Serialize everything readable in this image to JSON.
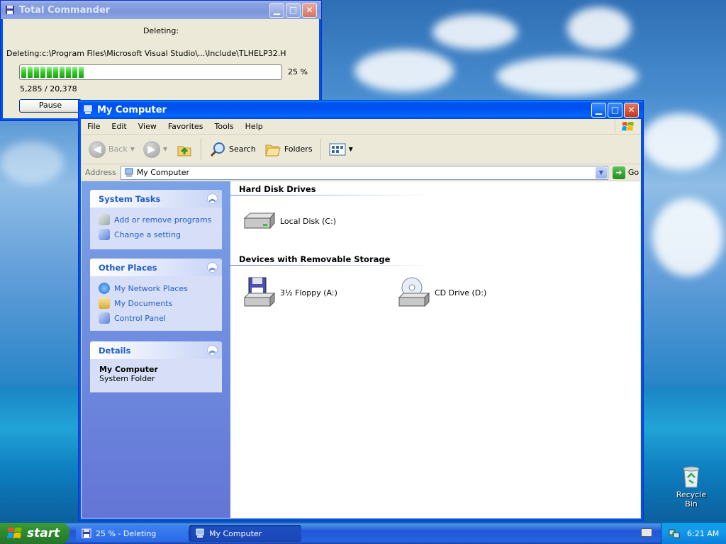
{
  "total_commander": {
    "title": "Total Commander",
    "heading": "Deleting:",
    "path": "Deleting:c:\\Program Files\\Microsoft Visual Studio\\...\\Include\\TLHELP32.H",
    "percent": "25 %",
    "progress": 0.25,
    "count": "5,285 / 20,378",
    "pause_label": "Pause"
  },
  "my_computer": {
    "title": "My Computer",
    "menu": [
      "File",
      "Edit",
      "View",
      "Favorites",
      "Tools",
      "Help"
    ],
    "toolbar": {
      "back": "Back",
      "search": "Search",
      "folders": "Folders"
    },
    "address": {
      "label": "Address",
      "value": "My Computer",
      "go": "Go"
    },
    "system_tasks": {
      "title": "System Tasks",
      "items": [
        "Add or remove programs",
        "Change a setting"
      ]
    },
    "other_places": {
      "title": "Other Places",
      "items": [
        "My Network Places",
        "My Documents",
        "Control Panel"
      ]
    },
    "details": {
      "title": "Details",
      "name": "My Computer",
      "type": "System Folder"
    },
    "sections": {
      "hard_disks": {
        "title": "Hard Disk Drives",
        "drives": [
          "Local Disk (C:)"
        ]
      },
      "removable": {
        "title": "Devices with Removable Storage",
        "drives": [
          "3½ Floppy (A:)",
          "CD Drive (D:)"
        ]
      }
    }
  },
  "desktop": {
    "recycle_bin": "Recycle Bin"
  },
  "taskbar": {
    "start": "start",
    "buttons": [
      "25 % - Deleting",
      "My Computer"
    ],
    "clock": "6:21 AM"
  }
}
